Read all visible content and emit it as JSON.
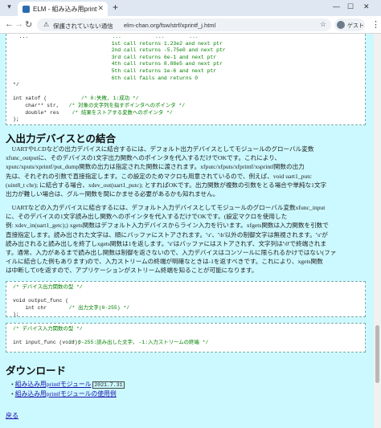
{
  "browser": {
    "tab_title": "ELM - 組み込み用printfモジュール",
    "security_label": "保護されていない通信",
    "url": "elm-chan.org/fsw/strf/xprintf_j.html",
    "guest_label": "ゲスト"
  },
  "code_top": [
    {
      "code": "  ...",
      "comment": "                ...           ...        ..."
    },
    {
      "code": "",
      "comment": "                                1st call returns 1.23e2 and next ptr"
    },
    {
      "code": "",
      "comment": "                                2nd call returns -5.75e0 and next ptr"
    },
    {
      "code": "",
      "comment": "                                3rd call returns 6e-1 and next ptr"
    },
    {
      "code": "",
      "comment": "                                4th call returns 8.88e5 and next ptr"
    },
    {
      "code": "",
      "comment": "                                5th call returns 1e-6 and next ptr"
    },
    {
      "code": "",
      "comment": "                                6th call fails and returns 0"
    },
    {
      "code": "*/",
      "comment": ""
    },
    {
      "code": "",
      "comment": ""
    },
    {
      "code": "int xatof (",
      "comment": "      /* 0:失敗, 1:成功 */"
    },
    {
      "code": "    char** str,",
      "comment": "  /* 対象の文字列を指すポインタへのポインタ */"
    },
    {
      "code": "    double* res",
      "comment": "   /* 結果をストアする変数へのポインタ */"
    },
    {
      "code": ");",
      "comment": ""
    }
  ],
  "section_device": {
    "heading": "入出力デバイスとの結合",
    "para1": [
      "　UARTやLCDなどの出力デバイスに結合するには、デフォルト出力デバイスとしてモジュールのグローバル変数",
      "xfunc_outputに、そのデバイスの1文字出力関数へのポインタを代入するだけでOKです。これにより、",
      "xputc/xputs/xprintf/put_dump関数の出力は指定された関数に渡されます。xfputc/xfputs/xfprintf/xsprintf関数の出力",
      "先は、それぞれの引数で直接指定します。この設定のためマクロも用意されているので、例えば、void uart1_putc",
      "(uint8_t chr); に結合する場合、xdev_out(uart1_putc); とすればOKです。出力関数が複数の引数をとる場合や単純な1文字",
      "出力が難しい場合は、グルー関数を間にかませる必要があるかも知れません。"
    ],
    "para2": [
      "　UARTなどの入力デバイスに結合するには、デフォルト入力デバイスとしてモジュールのグローバル変数xfunc_input",
      "に、そのデバイスの1文字読み出し関数へのポインタを代入するだけでOKです。(設定マクロを使用した",
      "例: xdev_in(uart1_getc);) xgets関数はデフォルト入力デバイスからライン入力を行います。xfgets関数は入力関数を引数で",
      "直接指定します。読み出された文字は、順にバッファにストアされます。'\\r'、'\\b'以外の制御文字は無視されます。'\\r'が",
      "読み出されると読み出しを終了しxgets関数は1を返します。'\\r'はバッファにはストアされず、文字列は'\\0'で終端されま",
      "す。通常、入力があるまで読み出し関数は制御を返さないので、入力デバイスはコンソールに限られるかけではない(ファ",
      "イルに結合した例もあります)ので、入力ストリームの終端が明確なときは-1を返すべきです。これにより、xgets関数",
      "は中断して0を返すので、アプリケーションがストリーム終端を知ることが可能になります。"
    ],
    "code_out": [
      {
        "code": "",
        "comment": "/* デバイス出力関数の型 */"
      },
      {
        "code": "",
        "comment": ""
      },
      {
        "code": "void output_func (",
        "comment": ""
      },
      {
        "code": "    int chr",
        "comment": "  /* 出力文字(0-255) */"
      },
      {
        "code": ");",
        "comment": ""
      }
    ],
    "code_in": [
      {
        "code": "",
        "comment": "/* デバイス入力関数の型 */"
      },
      {
        "code": "",
        "comment": ""
      },
      {
        "code": "int input_func (void);",
        "comment": "  /* 0-255:読み出した文字, -1:入力ストリームの終端 */"
      }
    ]
  },
  "section_download": {
    "heading": "ダウンロード",
    "items": [
      {
        "label": "組み込み用printfモジュール",
        "date": "2021.7.31"
      },
      {
        "label": "組み込み用printfモジュールの使用例",
        "date": ""
      }
    ],
    "back_label": "戻る"
  },
  "colors": {
    "page_bg": "#ccf9ff",
    "comment": "#008000",
    "link": "#1a0dab"
  }
}
